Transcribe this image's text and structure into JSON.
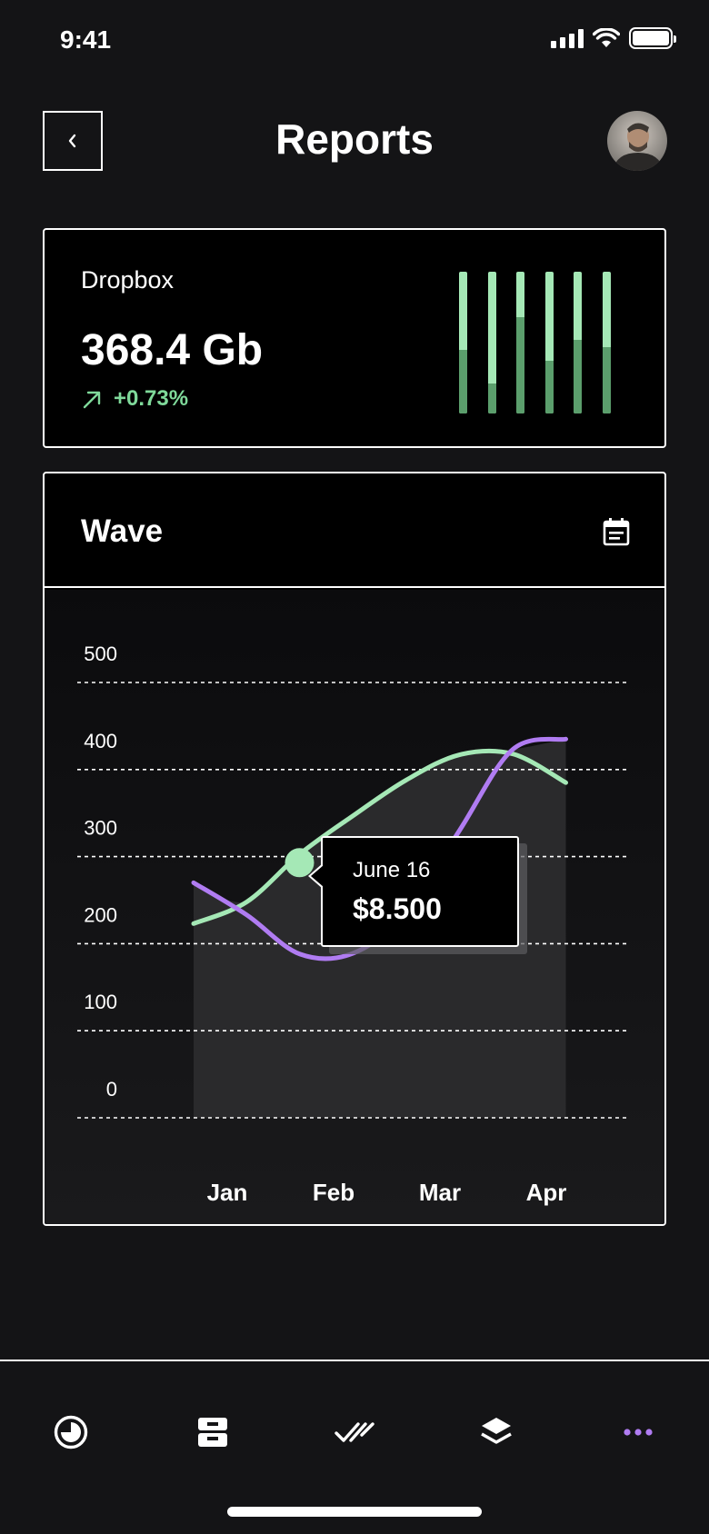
{
  "status_bar": {
    "time": "9:41"
  },
  "header": {
    "title": "Reports",
    "back_icon": "chevron-left-icon",
    "avatar": "user-avatar"
  },
  "storage_card": {
    "name": "Dropbox",
    "value": "368.4 Gb",
    "change": "+0.73%",
    "change_icon": "arrow-up-right-icon",
    "accent_color": "#a5e8b6",
    "bar_levels": [
      0.45,
      0.21,
      0.68,
      0.37,
      0.52,
      0.47
    ]
  },
  "chart_card": {
    "title": "Wave",
    "calendar_icon": "calendar-icon",
    "tooltip": {
      "date": "June 16",
      "value": "$8.500"
    }
  },
  "chart_data": {
    "type": "line",
    "categories": [
      "Jan",
      "Feb",
      "Mar",
      "Apr"
    ],
    "y_ticks": [
      500,
      400,
      300,
      200,
      100,
      0
    ],
    "ylim": [
      0,
      500
    ],
    "grid": true,
    "series": [
      {
        "color": "#a5e8b6",
        "points": [
          [
            0.0,
            223
          ],
          [
            0.5,
            248
          ],
          [
            1.0,
            303
          ],
          [
            1.5,
            347
          ],
          [
            2.0,
            388
          ],
          [
            2.5,
            417
          ],
          [
            3.0,
            418
          ],
          [
            3.5,
            385
          ]
        ]
      },
      {
        "color": "#b07cf2",
        "points": [
          [
            0.0,
            270
          ],
          [
            0.5,
            233
          ],
          [
            1.0,
            188
          ],
          [
            1.5,
            189
          ],
          [
            2.0,
            236
          ],
          [
            2.5,
            330
          ],
          [
            3.0,
            423
          ],
          [
            3.5,
            435
          ]
        ]
      }
    ],
    "area_fill": {
      "color": "#2a2a2c",
      "max_series_index": 0
    },
    "highlight": {
      "series_index": 0,
      "x": 1.0,
      "y": 293
    }
  },
  "tab_bar": {
    "items": [
      {
        "name": "tab-analytics",
        "icon": "pie-clock-icon",
        "active": false
      },
      {
        "name": "tab-inbox",
        "icon": "inbox-tray-icon",
        "active": false
      },
      {
        "name": "tab-tasks",
        "icon": "double-check-icon",
        "active": false
      },
      {
        "name": "tab-layers",
        "icon": "layers-icon",
        "active": false
      },
      {
        "name": "tab-more",
        "icon": "more-dots-icon",
        "active": true
      }
    ],
    "active_color": "#b07cf2"
  }
}
